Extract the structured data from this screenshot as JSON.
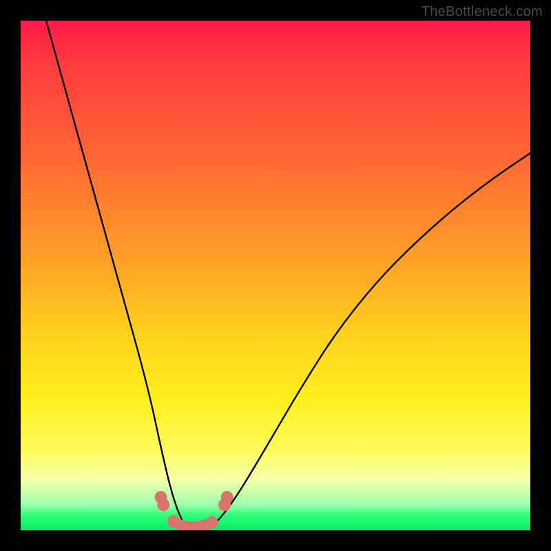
{
  "watermark": "TheBottleneck.com",
  "chart_data": {
    "type": "line",
    "title": "",
    "xlabel": "",
    "ylabel": "",
    "xlim": [
      0,
      100
    ],
    "ylim": [
      0,
      100
    ],
    "series": [
      {
        "name": "bottleneck-curve",
        "x": [
          5,
          10,
          15,
          20,
          25,
          28,
          30,
          32,
          34,
          36,
          38,
          42,
          48,
          55,
          62,
          70,
          78,
          86,
          94,
          100
        ],
        "values": [
          100,
          82,
          64,
          46,
          28,
          14,
          6,
          1,
          0,
          0,
          1,
          6,
          16,
          28,
          39,
          49,
          57,
          64,
          70,
          74
        ]
      }
    ],
    "markers": [
      {
        "name": "dot",
        "x": 27.5,
        "y": 6.5
      },
      {
        "name": "dot",
        "x": 28.0,
        "y": 5.0
      },
      {
        "name": "dot",
        "x": 30.0,
        "y": 1.8
      },
      {
        "name": "dot",
        "x": 31.5,
        "y": 0.9
      },
      {
        "name": "dot",
        "x": 33.0,
        "y": 0.6
      },
      {
        "name": "dot",
        "x": 34.5,
        "y": 0.6
      },
      {
        "name": "dot",
        "x": 36.0,
        "y": 0.9
      },
      {
        "name": "dot",
        "x": 37.5,
        "y": 1.6
      },
      {
        "name": "dot",
        "x": 40.0,
        "y": 5.0
      },
      {
        "name": "dot",
        "x": 40.5,
        "y": 6.5
      }
    ],
    "gradient_stops": [
      {
        "pos": 0,
        "color": "#ff1a4a"
      },
      {
        "pos": 28,
        "color": "#ff6a33"
      },
      {
        "pos": 62,
        "color": "#ffd21e"
      },
      {
        "pos": 90,
        "color": "#f7ffa8"
      },
      {
        "pos": 100,
        "color": "#08e869"
      }
    ],
    "marker_color": "#d9736b",
    "curve_color": "#000000"
  }
}
